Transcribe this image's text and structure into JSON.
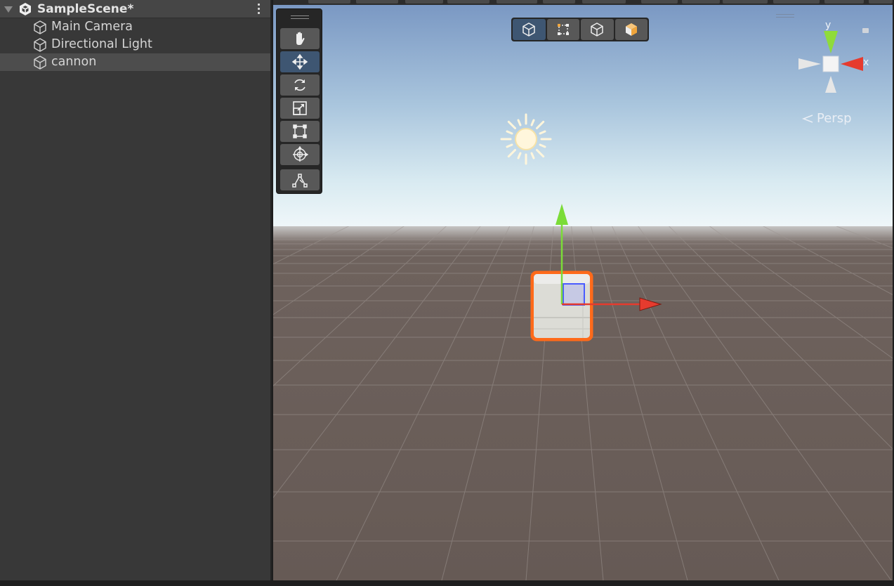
{
  "hierarchy": {
    "scene_name": "SampleScene*",
    "items": [
      {
        "label": "Main Camera",
        "selected": false
      },
      {
        "label": "Directional Light",
        "selected": false
      },
      {
        "label": "cannon",
        "selected": true
      }
    ]
  },
  "scene_view": {
    "tools": [
      "hand-tool",
      "move-tool",
      "rotate-tool",
      "scale-tool",
      "rect-tool",
      "transform-tool",
      "custom-editor-tool"
    ],
    "active_tool": "move-tool",
    "view_modes": [
      "shaded-cube",
      "rect-mode",
      "wire-cube",
      "lit-cube"
    ],
    "active_view_mode": "shaded-cube",
    "projection_label": "Persp",
    "gizmo_axes": {
      "y": "y",
      "x": "x"
    }
  },
  "colors": {
    "panel_bg": "#383838",
    "selection": "#4d4d4d",
    "active_tool": "#3e5672",
    "sky_top": "#7d9bc6",
    "horizon": "#eef6f9",
    "ground": "#6b5f5a",
    "outline": "#ff6a1a",
    "axis_x": "#e63b2e",
    "axis_y": "#7bdc38"
  }
}
